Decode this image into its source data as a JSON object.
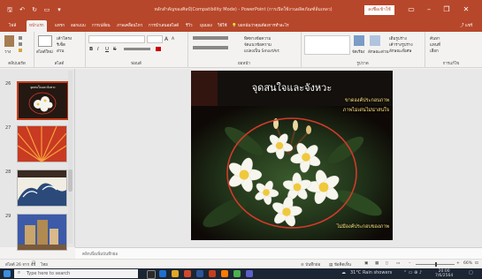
{
  "window": {
    "title": "หลักสำคัญของศิลป์(Compatibility Mode) - PowerPoint (การเปิดใช้งานผลิตภัณฑ์ล้มเหลว)",
    "signin_label": "ลงชื่อเข้าใช้",
    "minimize": "–",
    "restore": "❐",
    "close": "✕",
    "ribbon_display": "▭"
  },
  "quick_access": {
    "save": "🖫",
    "undo": "↶",
    "redo": "↻",
    "start": "▭",
    "more": "▾"
  },
  "tabs": [
    {
      "label": "ไฟล์"
    },
    {
      "label": "หน้าแรก"
    },
    {
      "label": "แทรก"
    },
    {
      "label": "ออกแบบ"
    },
    {
      "label": "การเปลี่ยน"
    },
    {
      "label": "ภาพเคลื่อนไหว"
    },
    {
      "label": "การนำเสนอสไลด์"
    },
    {
      "label": "รีวิว"
    },
    {
      "label": "มุมมอง"
    },
    {
      "label": "วิธีใช้"
    },
    {
      "label": "บอกฉันว่าคุณต้องการทำอะไร"
    }
  ],
  "share_label": "แชร์",
  "ribbon": {
    "clipboard": {
      "paste": "วาง",
      "cut": "ตัด",
      "copy": "คัดลอก",
      "format": "รูปแบบ",
      "label": "คลิปบอร์ด"
    },
    "slides": {
      "new_slide": "สไลด์ใหม่",
      "layout": "เค้าโครง",
      "reset": "รีเซ็ต",
      "section": "ส่วน",
      "label": "สไลด์"
    },
    "font": {
      "bold": "B",
      "italic": "I",
      "underline": "U",
      "strike": "S",
      "size_up": "A",
      "label": "ฟอนต์"
    },
    "paragraph": {
      "label": "ย่อหน้า",
      "text_direction": "ทิศทางข้อความ",
      "align_text": "จัดแนวข้อความ",
      "smartart": "แปลงเป็น SmartArt"
    },
    "drawing": {
      "arrange": "จัดเรียง",
      "quick_styles": "ลักษณะด่วน",
      "shape_fill": "เติมรูปร่าง",
      "shape_outline": "เค้าร่างรูปร่าง",
      "shape_effects": "ลักษณะพิเศษ",
      "label": "รูปวาด"
    },
    "editing": {
      "find": "ค้นหา",
      "replace": "แทนที่",
      "select": "เลือก",
      "label": "การแก้ไข"
    }
  },
  "thumbnails": [
    {
      "number": "26",
      "caption": "จุดสนใจและจังหวะ",
      "selected": true
    },
    {
      "number": "27",
      "caption": "",
      "selected": false
    },
    {
      "number": "28",
      "caption": "",
      "selected": false
    },
    {
      "number": "29",
      "caption": "",
      "selected": false
    }
  ],
  "slide": {
    "title": "จุดสนใจและจังหวะ",
    "subtitle_line1": "ขาดองค์ประกอบภาพ",
    "subtitle_line2": "ภาพไม่เด่นไม่น่าสนใจ",
    "bottom_caption": "ไม่มีองค์ประกอบของภาพ"
  },
  "notes_placeholder": "คลิกเพื่อเพิ่มบันทึกย่อ",
  "statusbar": {
    "slide_info": "สไลด์ 26 จาก 44",
    "language": "ไทย",
    "notes_label": "บันทึกย่อ",
    "comments_label": "ข้อคิดเห็น",
    "zoom": "66%"
  },
  "taskbar": {
    "search_placeholder": "Type here to search",
    "weather": "31°C  Rain showers",
    "time": "20:00",
    "date": "7/6/2564"
  },
  "colors": {
    "accent": "#b7472a",
    "title_text": "#ffffff",
    "subtitle_text": "#ffe680",
    "ellipse": "#d23a2a"
  }
}
